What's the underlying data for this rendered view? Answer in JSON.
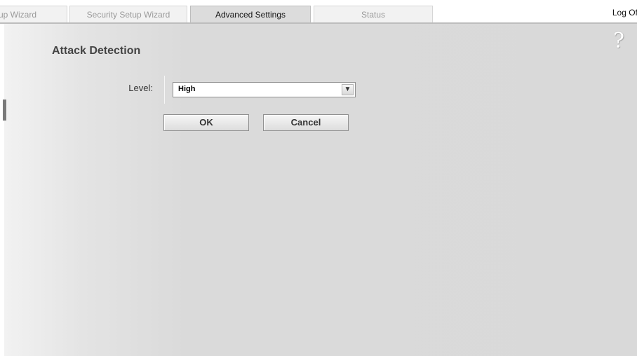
{
  "tabs": [
    {
      "label": "up Wizard",
      "active": false
    },
    {
      "label": "Security Setup Wizard",
      "active": false
    },
    {
      "label": "Advanced Settings",
      "active": true
    },
    {
      "label": "Status",
      "active": false
    }
  ],
  "header": {
    "logoff_label": "Log Off",
    "help_glyph": "?",
    "help_icon": "help-question-icon"
  },
  "page": {
    "title": "Attack Detection"
  },
  "form": {
    "level_label": "Level:",
    "level_value": "High",
    "ok_label": "OK",
    "cancel_label": "Cancel"
  },
  "colors": {
    "panel": "#d9d9d9",
    "active_tab": "#dcdcdc",
    "inactive_tab_text": "#9a9a9a"
  }
}
